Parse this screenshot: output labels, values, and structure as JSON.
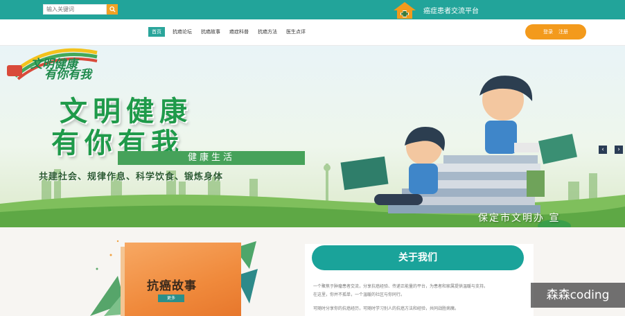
{
  "search": {
    "placeholder": "输入关键词",
    "icon": "search-icon"
  },
  "brand": {
    "title": "癌症患者交流平台",
    "icon": "home-plus-icon"
  },
  "nav": {
    "items": [
      "首页",
      "抗癌论坛",
      "抗癌故事",
      "癌症科普",
      "抗癌方法",
      "医生点评"
    ],
    "active_index": 0
  },
  "auth": {
    "login": "登录",
    "register": "注册"
  },
  "banner": {
    "logo_line1": "文明健康",
    "logo_line2": "有你有我",
    "headline_line1": "文明健康",
    "headline_line2": "有你有我",
    "ribbon": "健康生活",
    "slogan": "共建社会、规律作息、科学饮食、锻炼身体",
    "footer": "保定市文明办  宣",
    "prev_icon": "chevron-left-icon",
    "next_icon": "chevron-right-icon"
  },
  "story": {
    "title": "抗癌故事",
    "more": "更多"
  },
  "about": {
    "title": "关于我们",
    "line1": "一个聚焦于肿瘤患者交流，分享抗癌经验、传递正能量的平台，为患者和家属提供温暖与支持。",
    "line2": "在这里，你并不孤单，一个温暖的社区与你同行。",
    "line3": "可随时分享你的抗癌经历，可随时学习别人的抗癌方法和经验，共同战胜病魔。"
  },
  "watermark": "森森coding",
  "colors": {
    "teal": "#22a49a",
    "orange": "#f39a1c",
    "green": "#1f9a4a"
  }
}
